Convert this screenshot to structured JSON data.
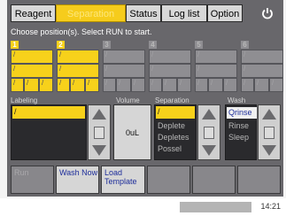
{
  "tabs": [
    {
      "label": "Reagent",
      "active": false
    },
    {
      "label": "Separation",
      "active": true
    },
    {
      "label": "Status",
      "active": false
    },
    {
      "label": "Log list",
      "active": false
    },
    {
      "label": "Option",
      "active": false
    }
  ],
  "power_icon": "power-icon",
  "instruction": "Choose position(s). Select RUN to start.",
  "positions": [
    {
      "number": "1",
      "selected": true,
      "slot_mark": "/"
    },
    {
      "number": "2",
      "selected": true,
      "slot_mark": "/"
    },
    {
      "number": "3",
      "selected": false,
      "slot_mark": "/"
    },
    {
      "number": "4",
      "selected": false,
      "slot_mark": "/"
    },
    {
      "number": "5",
      "selected": false,
      "slot_mark": "/"
    },
    {
      "number": "6",
      "selected": false,
      "slot_mark": "/"
    }
  ],
  "labeling": {
    "label": "Labeling",
    "selected": "/"
  },
  "volume": {
    "label": "Volume",
    "value": "0uL"
  },
  "separation": {
    "label": "Separation",
    "selected": "/",
    "options": [
      "Deplete",
      "Depletes",
      "Possel"
    ]
  },
  "wash": {
    "label": "Wash",
    "options": [
      "Qrinse",
      "Rinse",
      "Sleep"
    ],
    "selected_index": 0
  },
  "buttons": {
    "run": "Run",
    "wash_now": "Wash Now",
    "load_template": "Load Template",
    "b4": "",
    "b5": "",
    "b6": ""
  },
  "status_time": "14:21",
  "colors": {
    "accent": "#f7d11b",
    "panel": "#68676b",
    "button_text": "#1d2d9a"
  }
}
